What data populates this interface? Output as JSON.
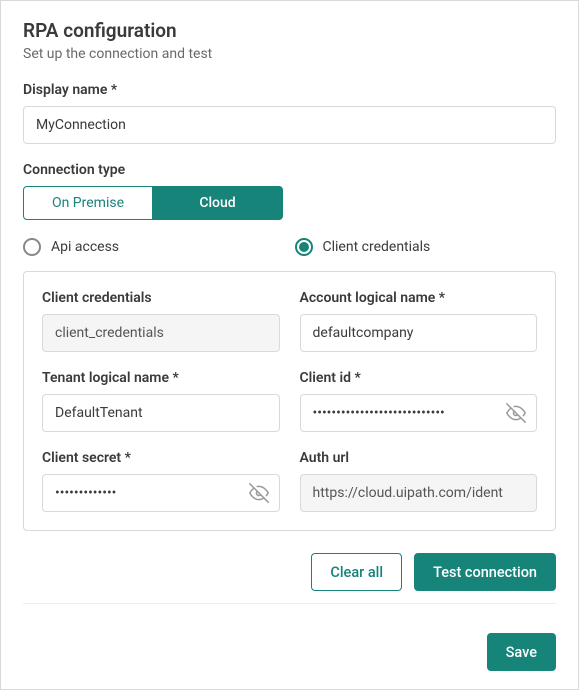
{
  "header": {
    "title": "RPA configuration",
    "subtitle": "Set up the connection and test"
  },
  "display_name": {
    "label": "Display name *",
    "value": "MyConnection"
  },
  "connection_type": {
    "label": "Connection type",
    "options": [
      "On Premise",
      "Cloud"
    ],
    "selected": "Cloud"
  },
  "auth_mode": {
    "options": [
      "Api access",
      "Client credentials"
    ],
    "selected": "Client credentials"
  },
  "credentials": {
    "grant_type": {
      "label": "Client credentials",
      "value": "client_credentials"
    },
    "account_logical_name": {
      "label": "Account logical name *",
      "value": "defaultcompany"
    },
    "tenant_logical_name": {
      "label": "Tenant logical name *",
      "value": "DefaultTenant"
    },
    "client_id": {
      "label": "Client id *",
      "value": "••••••••••••••••••••••••••••"
    },
    "client_secret": {
      "label": "Client secret *",
      "value": "•••••••••••••"
    },
    "auth_url": {
      "label": "Auth url",
      "value": "https://cloud.uipath.com/ident"
    }
  },
  "actions": {
    "clear_all": "Clear all",
    "test_connection": "Test connection",
    "save": "Save"
  },
  "colors": {
    "accent": "#17847a"
  }
}
